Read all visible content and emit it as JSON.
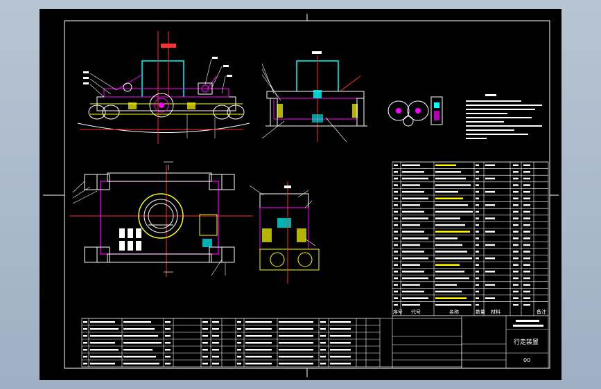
{
  "window": {
    "background_color": "#a9b8c9",
    "viewport_color": "#000000"
  },
  "title_block": {
    "seq_header": "序号",
    "code_header": "代号",
    "name_header": "名称",
    "qty_header": "数量",
    "material_header": "材料",
    "remarks_header": "备注",
    "drawing_title": "行走装置",
    "drawing_number": "00"
  },
  "colors": {
    "frame": "#ffffff",
    "magenta": "#ff00ff",
    "cyan": "#00ffff",
    "yellow": "#ffff00",
    "red": "#ff3030",
    "green": "#00ff00"
  }
}
